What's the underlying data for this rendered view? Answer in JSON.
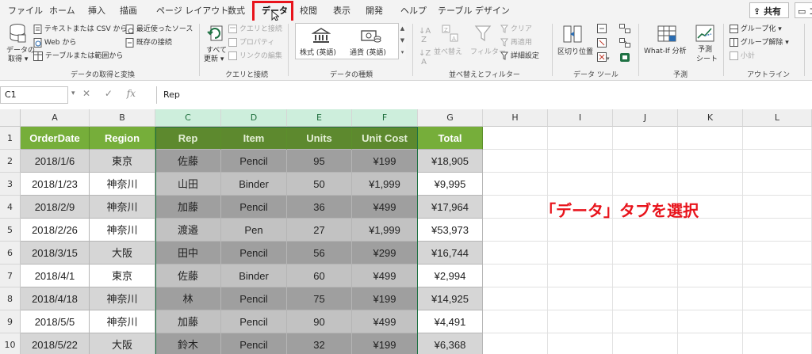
{
  "tabs": [
    {
      "label": "ファイル"
    },
    {
      "label": "ホーム"
    },
    {
      "label": "挿入"
    },
    {
      "label": "描画"
    },
    {
      "label": "ページ レイアウト"
    },
    {
      "label": "数式"
    },
    {
      "label": "データ"
    },
    {
      "label": "校閲"
    },
    {
      "label": "表示"
    },
    {
      "label": "開発"
    },
    {
      "label": "ヘルプ"
    },
    {
      "label": "テーブル デザイン"
    }
  ],
  "active_tab": "データ",
  "share_label": "共有",
  "comment_label": "コ",
  "ribbon": {
    "get_data": {
      "big_label_1": "データの",
      "big_label_2": "取得 ▾",
      "text_csv": "テキストまたは CSV から",
      "web": "Web から",
      "table_range": "テーブルまたは範囲から",
      "recent_sources": "最近使ったソース",
      "existing_connections": "既存の接続",
      "group_label": "データの取得と変換"
    },
    "queries": {
      "refresh_1": "すべて",
      "refresh_2": "更新 ▾",
      "queries_connections": "クエリと接続",
      "properties": "プロパティ",
      "edit_links": "リンクの編集",
      "group_label": "クエリと接続"
    },
    "data_types": {
      "stocks": "株式 (英語)",
      "currency": "通貨 (英語)",
      "group_label": "データの種類"
    },
    "sort_filter": {
      "sort": "並べ替え",
      "filter": "フィルター",
      "clear": "クリア",
      "reapply": "再適用",
      "advanced": "詳細設定",
      "group_label": "並べ替えとフィルター"
    },
    "data_tools": {
      "text_to_columns": "区切り位置",
      "group_label": "データ ツール"
    },
    "forecast": {
      "whatif": "What-If 分析",
      "forecast_sheet_1": "予測",
      "forecast_sheet_2": "シート",
      "group_label": "予測"
    },
    "outline": {
      "group": "グループ化",
      "ungroup": "グループ解除",
      "subtotal": "小計",
      "group_label": "アウトライン"
    }
  },
  "formula_bar": {
    "name_box": "C1",
    "fx": "fx",
    "value": "Rep"
  },
  "columns": [
    "A",
    "B",
    "C",
    "D",
    "E",
    "F",
    "G",
    "H",
    "I",
    "J",
    "K",
    "L"
  ],
  "selected_columns": [
    "C",
    "D",
    "E",
    "F"
  ],
  "table": {
    "headers": [
      "OrderDate",
      "Region",
      "Rep",
      "Item",
      "Units",
      "Unit Cost",
      "Total"
    ],
    "rows": [
      [
        "2018/1/6",
        "東京",
        "佐藤",
        "Pencil",
        "95",
        "¥199",
        "¥18,905"
      ],
      [
        "2018/1/23",
        "神奈川",
        "山田",
        "Binder",
        "50",
        "¥1,999",
        "¥9,995"
      ],
      [
        "2018/2/9",
        "神奈川",
        "加藤",
        "Pencil",
        "36",
        "¥499",
        "¥17,964"
      ],
      [
        "2018/2/26",
        "神奈川",
        "渡邉",
        "Pen",
        "27",
        "¥1,999",
        "¥53,973"
      ],
      [
        "2018/3/15",
        "大阪",
        "田中",
        "Pencil",
        "56",
        "¥299",
        "¥16,744"
      ],
      [
        "2018/4/1",
        "東京",
        "佐藤",
        "Binder",
        "60",
        "¥499",
        "¥2,994"
      ],
      [
        "2018/4/18",
        "神奈川",
        "林",
        "Pencil",
        "75",
        "¥199",
        "¥14,925"
      ],
      [
        "2018/5/5",
        "神奈川",
        "加藤",
        "Pencil",
        "90",
        "¥499",
        "¥4,491"
      ],
      [
        "2018/5/22",
        "大阪",
        "鈴木",
        "Pencil",
        "32",
        "¥199",
        "¥6,368"
      ]
    ]
  },
  "row_numbers": [
    "1",
    "2",
    "3",
    "4",
    "5",
    "6",
    "7",
    "8",
    "9",
    "10"
  ],
  "annotation": "「データ」タブを選択"
}
